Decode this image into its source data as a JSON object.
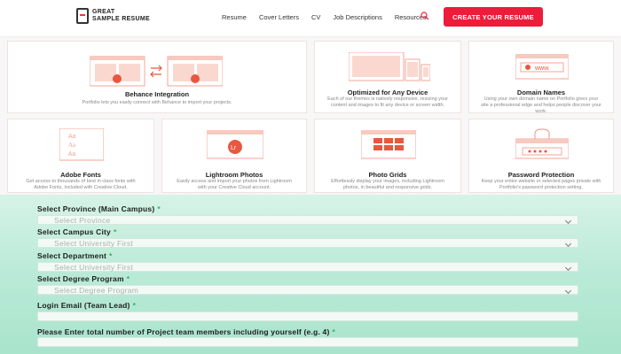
{
  "header": {
    "logo_line1": "GREAT",
    "logo_line2": "SAMPLE RESUME",
    "nav": [
      "Resume",
      "Cover Letters",
      "CV",
      "Job Descriptions",
      "Resources"
    ],
    "cta": "CREATE YOUR RESUME",
    "accent": "#ec1c3a"
  },
  "features": [
    {
      "title": "Behance Integration",
      "desc": "Portfolio lets you easily connect with Behance to import your projects."
    },
    {
      "title": "Optimized for Any Device",
      "desc": "Each of our themes is natively responsive, resizing your content and images to fit any device or screen width."
    },
    {
      "title": "Domain Names",
      "desc": "Using your own domain name on Portfolio gives your site a professional edge and helps people discover your work."
    },
    {
      "title": "Adobe Fonts",
      "desc": "Get access to thousands of best in class fonts with Adobe Fonts, included with Creative Cloud."
    },
    {
      "title": "Lightroom Photos",
      "desc": "Easily access and import your photos from Lightroom with your Creative Cloud account."
    },
    {
      "title": "Photo Grids",
      "desc": "Effortlessly display your images, including Lightroom photos, in beautiful and responsive grids."
    },
    {
      "title": "Password Protection",
      "desc": "Keep your entire website or selected pages private with Portfolio's password protection setting."
    }
  ],
  "feature_badges": {
    "behance_left": "Bē",
    "behance_right": "Pf",
    "adobe_text": "Aa",
    "lightroom": "Lr",
    "domain": "www."
  },
  "form": {
    "province_label": "Select Province (Main Campus)",
    "province_placeholder": "Select Province",
    "city_label": "Select Campus City",
    "city_placeholder": "Select University First",
    "department_label": "Select Department",
    "department_placeholder": "Select University First",
    "degree_label": "Select Degree Program",
    "degree_placeholder": "Select Degree Program",
    "email_label": "Login Email (Team Lead)",
    "members_label": "Please Enter total number of Project team members including yourself (e.g. 4)",
    "required_mark": "*",
    "accent": "#2bb36b"
  }
}
